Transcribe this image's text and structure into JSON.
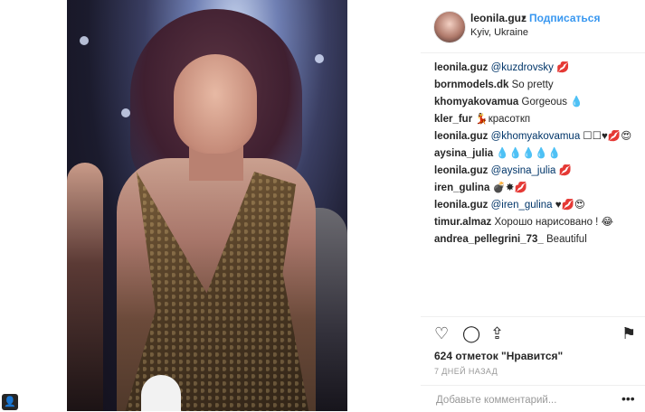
{
  "post": {
    "username": "leonila.guz",
    "separator": "•",
    "follow_label": "Подписаться",
    "location": "Kyiv, Ukraine"
  },
  "comments": [
    {
      "user": "leonila.guz",
      "mention": "@kuzdrovsky",
      "text": " 💋"
    },
    {
      "user": "bornmodels.dk",
      "mention": "",
      "text": " So pretty"
    },
    {
      "user": "khomyakovamua",
      "mention": "",
      "text": " Gorgeous 💧"
    },
    {
      "user": "kler_fur",
      "mention": "",
      "text": " 💃красоткп"
    },
    {
      "user": "leonila.guz",
      "mention": "@khomyakovamua",
      "text": " ☐☐♥💋😍"
    },
    {
      "user": "aysina_julia",
      "mention": "",
      "text": " 💧💧💧💧💧"
    },
    {
      "user": "leonila.guz",
      "mention": "@aysina_julia",
      "text": " 💋"
    },
    {
      "user": "iren_gulina",
      "mention": "",
      "text": " 💣✸💋"
    },
    {
      "user": "leonila.guz",
      "mention": "@iren_gulina",
      "text": " ♥💋😍"
    },
    {
      "user": "timur.almaz",
      "mention": "",
      "text": " Хорошо нарисовано ! 😂"
    },
    {
      "user": "andrea_pellegrini_73_",
      "mention": "",
      "text": " Beautiful"
    }
  ],
  "actions": {
    "like_icon": "♡",
    "comment_icon": "◯",
    "share_icon": "⇪",
    "save_icon": "⚑"
  },
  "likes_text": "624 отметок \"Нравится\"",
  "time_text": "7 ДНЕЙ НАЗАД",
  "add_comment": {
    "placeholder": "Добавьте комментарий...",
    "more_icon": "•••"
  },
  "colors": {
    "link": "#3897f0",
    "text": "#262626",
    "muted": "#999999"
  }
}
